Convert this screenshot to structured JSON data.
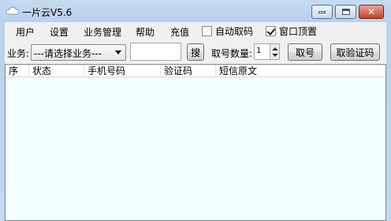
{
  "window": {
    "title": "一片云V5.6",
    "icon": "cloud-icon",
    "controls": {
      "minimize": "minimize-icon",
      "maximize": "maximize-icon",
      "close_glyph": "✕"
    }
  },
  "menu": {
    "items": [
      "用户",
      "设置",
      "业务管理",
      "帮助",
      "充值"
    ],
    "auto_fetch_label": "自动取码",
    "auto_fetch_checked": false,
    "topmost_label": "窗口顶置",
    "topmost_checked": true
  },
  "toolbar": {
    "service_label": "业务:",
    "service_select_value": "---请选择业务---",
    "search_value": "",
    "search_button": "搜",
    "count_label": "取号数量:",
    "count_value": "1",
    "get_number_button": "取号",
    "get_code_button": "取验证码"
  },
  "table": {
    "columns": [
      "序",
      "状态",
      "手机号码",
      "验证码",
      "短信原文"
    ],
    "rows": []
  },
  "colors": {
    "list_background": "#f0ffff",
    "close_button": "#c4412c",
    "title_bar": "#bcd4ee"
  }
}
